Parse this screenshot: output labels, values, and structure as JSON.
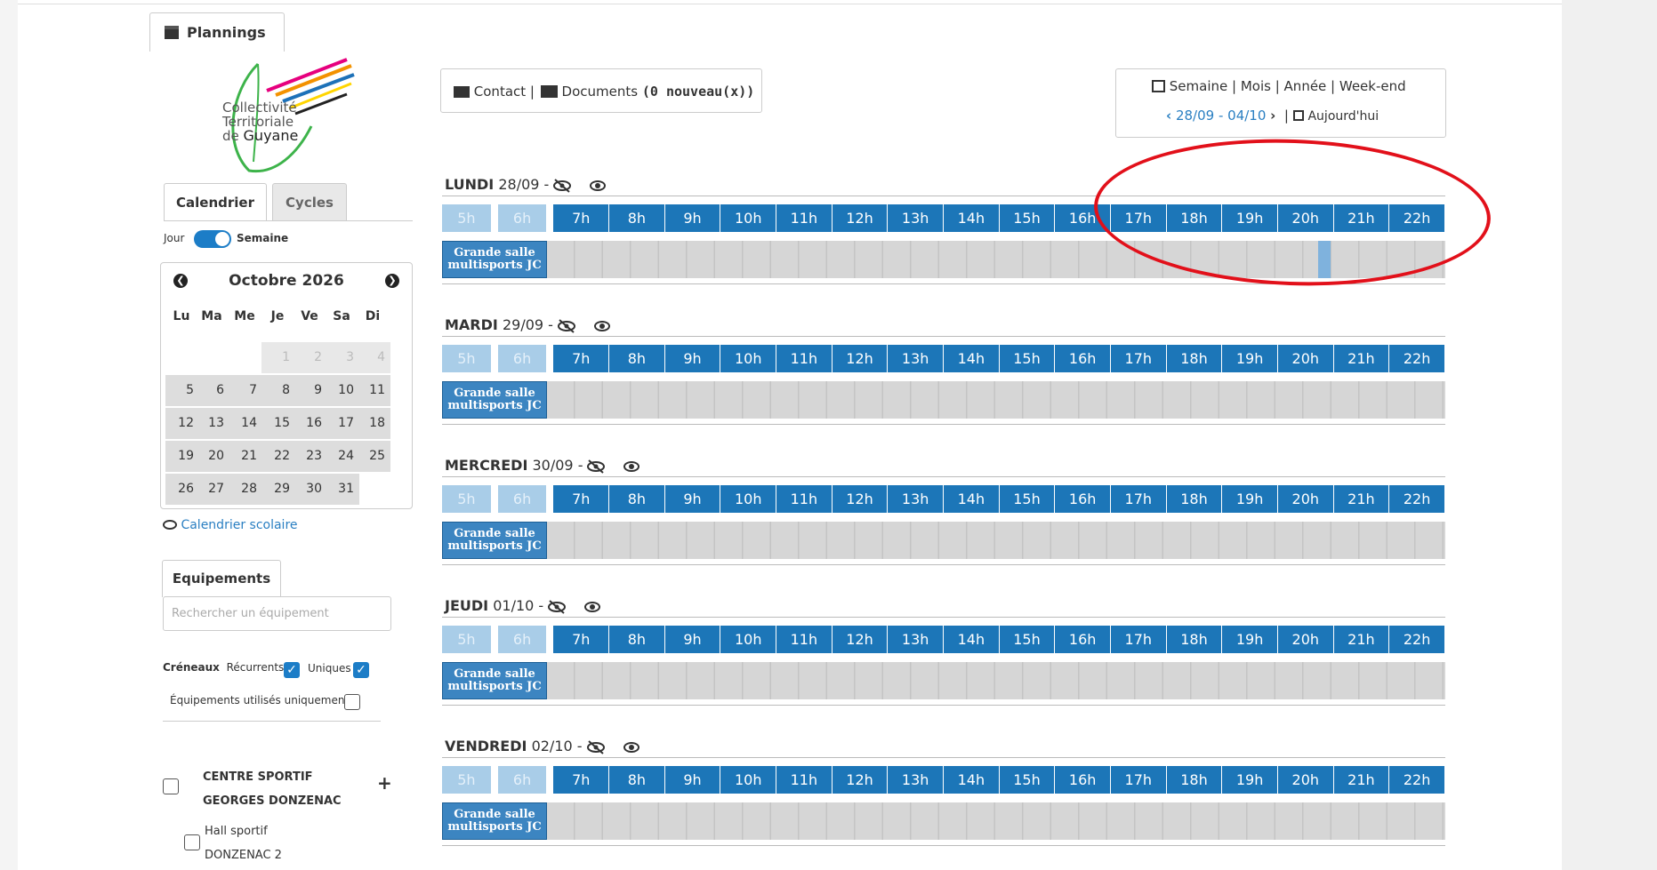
{
  "plannings_tab": "Plannings",
  "logo": {
    "line1": "Collectivité",
    "line2": "Territoriale",
    "line3_prefix": "de ",
    "line3_brand": "Guyane"
  },
  "contact_bar": {
    "contact": "Contact",
    "sep": "|",
    "documents": "Documents",
    "new_docs": "(0 nouveau(x))"
  },
  "view_bar": {
    "views": [
      "Semaine",
      "Mois",
      "Année",
      "Week-end"
    ],
    "range": "28/09 - 04/10",
    "today": "Aujourd'hui"
  },
  "side_tabs": {
    "calendar": "Calendrier",
    "cycles": "Cycles"
  },
  "toggle": {
    "day": "Jour",
    "week": "Semaine"
  },
  "calendar": {
    "month": "Octobre 2026",
    "weekdays": [
      "Lu",
      "Ma",
      "Me",
      "Je",
      "Ve",
      "Sa",
      "Di"
    ],
    "lead_days": [
      "1",
      "2",
      "3",
      "4"
    ],
    "weeks": [
      [
        "5",
        "6",
        "7",
        "8",
        "9",
        "10",
        "11"
      ],
      [
        "12",
        "13",
        "14",
        "15",
        "16",
        "17",
        "18"
      ],
      [
        "19",
        "20",
        "21",
        "22",
        "23",
        "24",
        "25"
      ],
      [
        "26",
        "27",
        "28",
        "29",
        "30",
        "31"
      ]
    ]
  },
  "school_calendar_link": "Calendrier scolaire",
  "equipments": {
    "tab": "Equipements",
    "search_placeholder": "Rechercher un équipement",
    "creneaux_label": "Créneaux",
    "recurrent": "Récurrents",
    "unique": "Uniques",
    "used_only": "Équipements utilisés uniquement",
    "center_line1": "CENTRE SPORTIF",
    "center_line2": "GEORGES DONZENAC",
    "plus": "+",
    "hall_line1": "Hall sportif",
    "hall_line2": "DONZENAC 2"
  },
  "hours": [
    "5h",
    "6h",
    "7h",
    "8h",
    "9h",
    "10h",
    "11h",
    "12h",
    "13h",
    "14h",
    "15h",
    "16h",
    "17h",
    "18h",
    "19h",
    "20h",
    "21h",
    "22h"
  ],
  "room_line1": "Grande salle",
  "room_line2": "multisports JC",
  "days": [
    {
      "name": "LUNDI",
      "date": "28/09 -"
    },
    {
      "name": "MARDI",
      "date": "29/09 -"
    },
    {
      "name": "MERCREDI",
      "date": "30/09 -"
    },
    {
      "name": "JEUDI",
      "date": "01/10 -"
    },
    {
      "name": "VENDREDI",
      "date": "02/10 -"
    }
  ],
  "colors": {
    "accent": "#1c76b8",
    "highlight_circle": "#e2101a",
    "booked_slot": "#7fb2dd"
  },
  "booked_slot_start_hour": "20h30"
}
